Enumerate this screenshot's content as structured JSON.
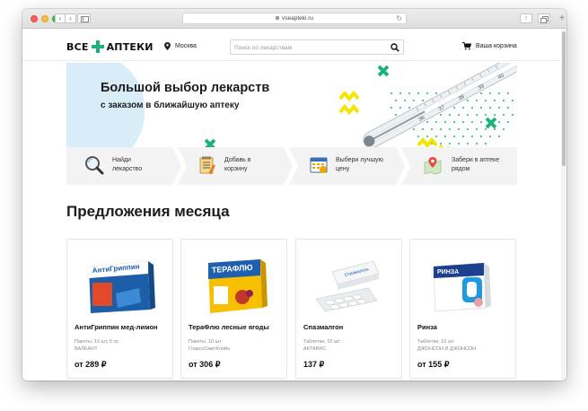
{
  "browser": {
    "url": "vseapteki.ru",
    "back_glyph": "‹",
    "forward_glyph": "›",
    "reload_glyph": "↻",
    "share_glyph": "↑",
    "new_tab_glyph": "+"
  },
  "header": {
    "logo_left": "ВСЕ",
    "logo_right": "АПТЕКИ",
    "city": "Москва",
    "search_placeholder": "Поиск по лекарствам",
    "cart_label": "Ваша корзина"
  },
  "banner": {
    "title": "Большой выбор лекарств",
    "subtitle": "с заказом в ближайшую аптеку",
    "thermometer_marks": [
      "36",
      "37",
      "38",
      "39",
      "40"
    ]
  },
  "steps": [
    {
      "line1": "Найди",
      "line2": "лекарство",
      "icon": "magnifier-icon"
    },
    {
      "line1": "Добавь в",
      "line2": "корзину",
      "icon": "list-icon"
    },
    {
      "line1": "Выбери лучшую",
      "line2": "цену",
      "icon": "calendar-icon"
    },
    {
      "line1": "Забери в аптеке",
      "line2": "рядом",
      "icon": "map-pin-icon"
    }
  ],
  "offers": {
    "title": "Предложения месяца",
    "items": [
      {
        "name": "АнтиГриппин мед-лимон",
        "pack": "Пакеты, 10 шт, 5 гр.",
        "maker": "ВАЛЕАНТ",
        "price": "от 289 ₽",
        "box_label": "АнтиГриппин"
      },
      {
        "name": "ТераФлю лесные ягоды",
        "pack": "Пакеты, 10 шт",
        "maker": "ГлаксоСмитКляйн",
        "price": "от 306 ₽",
        "box_label": "ТЕРАФЛЮ"
      },
      {
        "name": "Спазмалгон",
        "pack": "Таблетки, 10 шт",
        "maker": "АКТАВИС",
        "price": "137 ₽",
        "box_label": "Спазмалгон"
      },
      {
        "name": "Ринза",
        "pack": "Таблетки, 10 шт",
        "maker": "ДЖОНСОН И ДЖОНСОН",
        "price": "от 155 ₽",
        "box_label": "РИНЗА"
      }
    ]
  },
  "colors": {
    "brand_green": "#1eb27a",
    "accent_yellow": "#f2e600",
    "banner_blue": "#d9edf9",
    "step_bg": "#f3f3f3"
  }
}
